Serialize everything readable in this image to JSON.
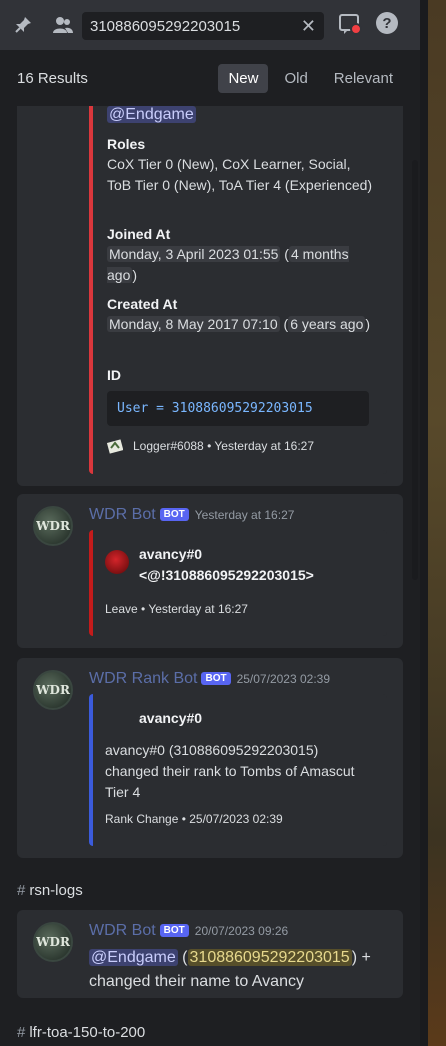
{
  "toolbar": {
    "search_query": "310886095292203015",
    "icons": [
      "pin-icon",
      "members-icon",
      "close-icon",
      "inbox-icon",
      "help-icon"
    ]
  },
  "results": {
    "count_label": "16 Results",
    "tabs": [
      "New",
      "Old",
      "Relevant"
    ],
    "active_tab": "New"
  },
  "result1": {
    "mention": "@Endgame",
    "roles_title": "Roles",
    "roles_value": "CoX Tier 0 (New), CoX Learner, Social, ToB Tier 0 (New), ToA Tier 4 (Experienced)",
    "joined_title": "Joined At",
    "joined_date": "Monday, 3 April 2023 01:55",
    "joined_rel": "4 months ago",
    "created_title": "Created At",
    "created_date": "Monday, 8 May 2017 07:10",
    "created_rel": "6 years ago",
    "id_title": "ID",
    "code": "User = 310886095292203015",
    "footer": "Logger#6088 • Yesterday at 16:27"
  },
  "result2": {
    "author": "WDR Bot",
    "badge": "BOT",
    "timestamp": "Yesterday at 16:27",
    "user": "avancy#0",
    "user_id": "<@!310886095292203015>",
    "footer": "Leave • Yesterday at 16:27"
  },
  "result3": {
    "author": "WDR Rank Bot",
    "badge": "BOT",
    "timestamp": "25/07/2023 02:39",
    "user": "avancy#0",
    "description": "avancy#0 (310886095292203015) changed their rank to Tombs of Amascut Tier 4",
    "footer": "Rank Change • 25/07/2023 02:39"
  },
  "channel1": "rsn-logs",
  "result4": {
    "author": "WDR Bot",
    "badge": "BOT",
    "timestamp": "20/07/2023 09:26",
    "mention": "@Endgame",
    "id": "310886095292203015",
    "text_after": "changed their name to Avancy"
  },
  "channel2": "lfr-toa-150-to-200",
  "avatar_text": "WDR"
}
